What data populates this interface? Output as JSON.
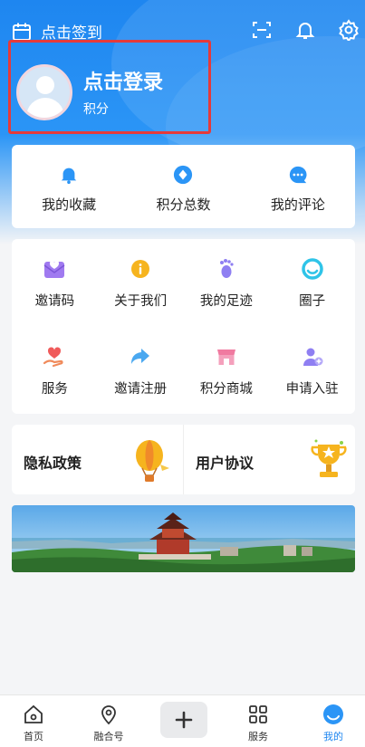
{
  "header": {
    "checkin_label": "点击签到",
    "login_title": "点击登录",
    "login_sub": "积分"
  },
  "stats": [
    {
      "label": "我的收藏",
      "icon": "bell-icon",
      "color": "#1e90ff"
    },
    {
      "label": "积分总数",
      "icon": "diamond-icon",
      "color": "#1e90ff"
    },
    {
      "label": "我的评论",
      "icon": "comment-icon",
      "color": "#1e90ff"
    }
  ],
  "grid": [
    {
      "label": "邀请码",
      "icon": "heart-mail-icon",
      "color": "#9b6fe8"
    },
    {
      "label": "关于我们",
      "icon": "info-icon",
      "color": "#f5b01a"
    },
    {
      "label": "我的足迹",
      "icon": "footprint-icon",
      "color": "#8a7cf0"
    },
    {
      "label": "圈子",
      "icon": "circle-icon",
      "color": "#2fc4e8"
    },
    {
      "label": "服务",
      "icon": "heart-hand-icon",
      "color": "#f06060"
    },
    {
      "label": "邀请注册",
      "icon": "share-arrow-icon",
      "color": "#4aa8f0"
    },
    {
      "label": "积分商城",
      "icon": "shop-icon",
      "color": "#f07aa0"
    },
    {
      "label": "申请入驻",
      "icon": "user-add-icon",
      "color": "#8a7cf0"
    }
  ],
  "promos": [
    {
      "label": "隐私政策",
      "icon": "balloon-icon"
    },
    {
      "label": "用户协议",
      "icon": "trophy-icon"
    }
  ],
  "tabs": [
    {
      "label": "首页",
      "icon": "home-icon"
    },
    {
      "label": "融合号",
      "icon": "location-icon"
    },
    {
      "label": "",
      "icon": "plus-icon"
    },
    {
      "label": "服务",
      "icon": "grid-icon"
    },
    {
      "label": "我的",
      "icon": "profile-icon"
    }
  ],
  "colors": {
    "accent": "#1e86f0",
    "highlight_border": "#e53a3a"
  }
}
